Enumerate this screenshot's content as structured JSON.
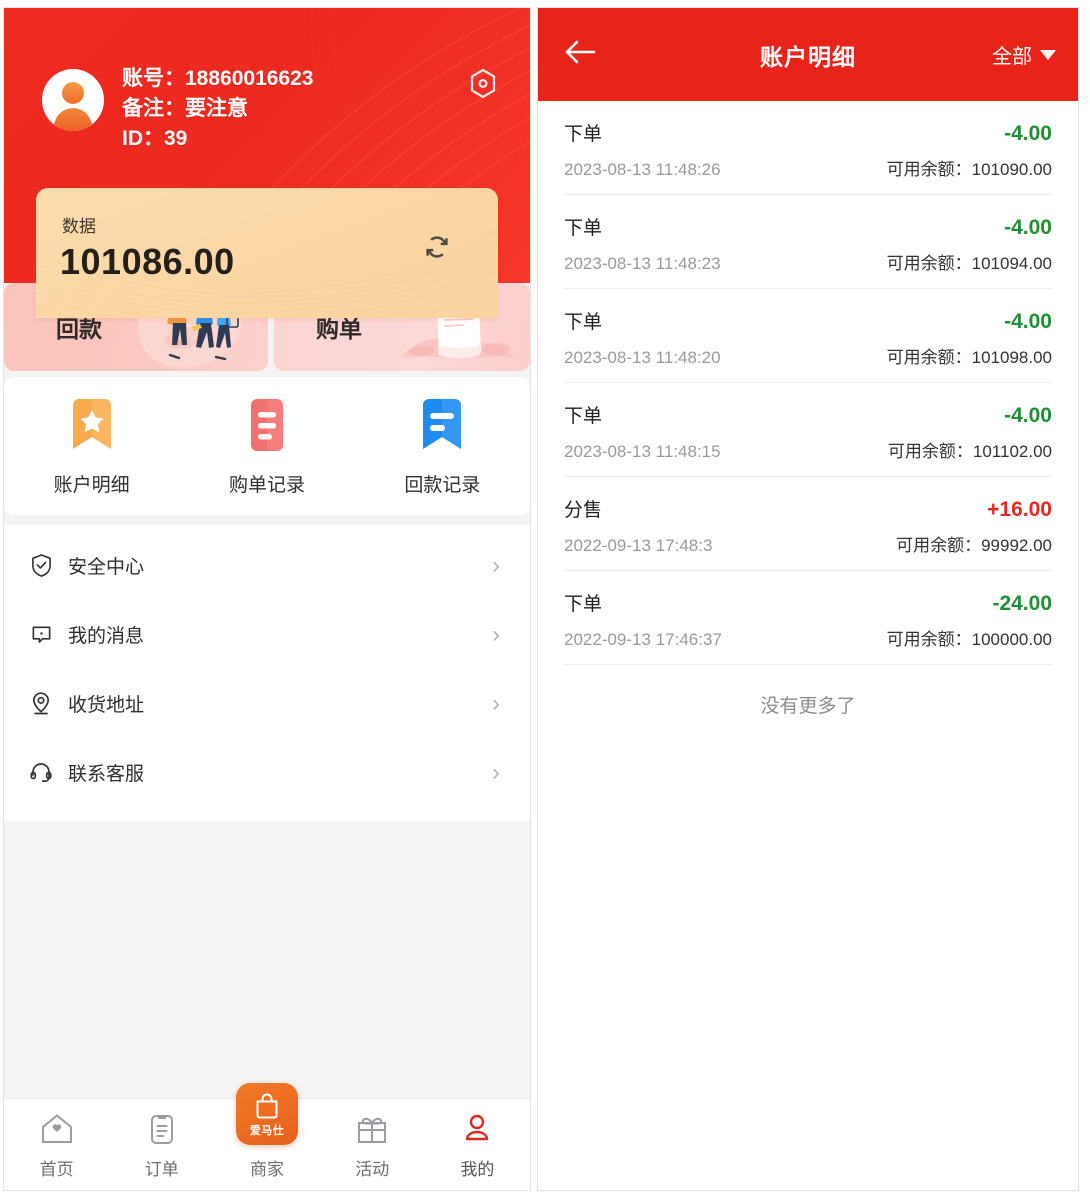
{
  "left_panel": {
    "profile": {
      "account_label": "账号：18860016623",
      "remark_label": "备注：要注意",
      "id_label": "ID：39",
      "settings_icon": "hexagon-settings-icon",
      "avatar_icon": "user-avatar-icon"
    },
    "data_card": {
      "label": "数据",
      "value": "101086.00",
      "refresh_icon": "refresh-icon"
    },
    "promos": [
      {
        "title": "回款",
        "icon": "people-delivery-illustration"
      },
      {
        "title": "购单",
        "icon": "clipboard-document-illustration"
      }
    ],
    "quick_actions": [
      {
        "label": "账户明细",
        "icon": "star-bookmark-icon",
        "color": "#f8ab4e"
      },
      {
        "label": "购单记录",
        "icon": "document-lines-icon",
        "color": "#f2716f"
      },
      {
        "label": "回款记录",
        "icon": "blue-bookmark-icon",
        "color": "#1f8bf0"
      }
    ],
    "menu": [
      {
        "label": "安全中心",
        "icon": "shield-check-icon"
      },
      {
        "label": "我的消息",
        "icon": "message-icon"
      },
      {
        "label": "收货地址",
        "icon": "location-pin-icon"
      },
      {
        "label": "联系客服",
        "icon": "headset-icon"
      }
    ],
    "tabs": [
      {
        "label": "首页",
        "icon": "home-icon",
        "active": false
      },
      {
        "label": "订单",
        "icon": "clipboard-icon",
        "active": false
      },
      {
        "label": "商家",
        "icon": "shopping-bag-icon",
        "badge_text": "爱马仕",
        "active": false
      },
      {
        "label": "活动",
        "icon": "gift-icon",
        "active": false
      },
      {
        "label": "我的",
        "icon": "person-icon",
        "active": true
      }
    ]
  },
  "right_panel": {
    "nav": {
      "back_icon": "back-arrow-icon",
      "title": "账户明细",
      "filter_label": "全部",
      "filter_caret_icon": "chevron-down-icon"
    },
    "balance_prefix": "可用余额：",
    "transactions": [
      {
        "title": "下单",
        "amount": "-4.00",
        "sign": "neg",
        "time": "2023-08-13 11:48:26",
        "balance": "101090.00"
      },
      {
        "title": "下单",
        "amount": "-4.00",
        "sign": "neg",
        "time": "2023-08-13 11:48:23",
        "balance": "101094.00"
      },
      {
        "title": "下单",
        "amount": "-4.00",
        "sign": "neg",
        "time": "2023-08-13 11:48:20",
        "balance": "101098.00"
      },
      {
        "title": "下单",
        "amount": "-4.00",
        "sign": "neg",
        "time": "2023-08-13 11:48:15",
        "balance": "101102.00"
      },
      {
        "title": "分售",
        "amount": "+16.00",
        "sign": "pos",
        "time": "2022-09-13 17:48:3",
        "balance": "99992.00"
      },
      {
        "title": "下单",
        "amount": "-24.00",
        "sign": "neg",
        "time": "2022-09-13 17:46:37",
        "balance": "100000.00"
      }
    ],
    "no_more_text": "没有更多了"
  },
  "colors": {
    "brand_red": "#e8241a",
    "header_red": "#ef2b21",
    "data_card_amber": "#fbd7a4",
    "negative_green": "#1e9033",
    "positive_red": "#e02b20",
    "merchant_orange": "#e8601b"
  }
}
